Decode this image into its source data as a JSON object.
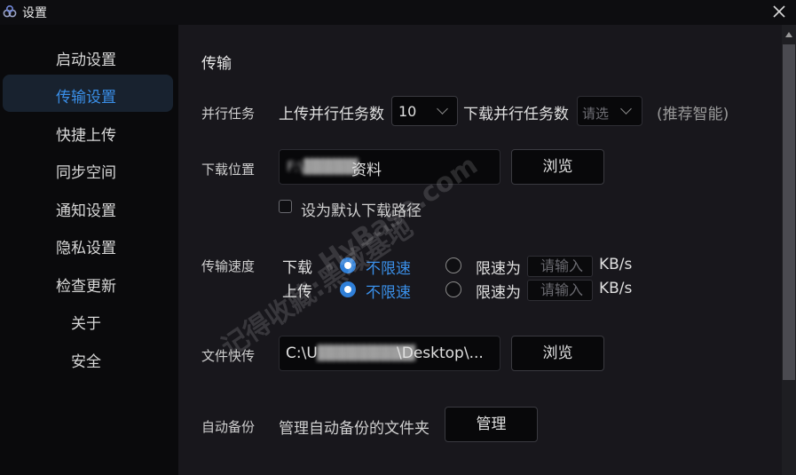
{
  "window": {
    "title": "设置",
    "close_icon": "close-icon"
  },
  "sidebar": {
    "items": [
      {
        "label": "启动设置"
      },
      {
        "label": "传输设置",
        "active": true
      },
      {
        "label": "快捷上传"
      },
      {
        "label": "同步空间"
      },
      {
        "label": "通知设置"
      },
      {
        "label": "隐私设置"
      },
      {
        "label": "检查更新"
      },
      {
        "label": "关于"
      },
      {
        "label": "安全"
      }
    ]
  },
  "main": {
    "section_title": "传输",
    "parallel": {
      "label": "并行任务",
      "upload_label": "上传并行任务数",
      "upload_value": "10",
      "download_label": "下载并行任务数",
      "download_placeholder": "请选",
      "hint": "(推荐智能)"
    },
    "download_location": {
      "label": "下载位置",
      "path_suffix": "资料",
      "browse_label": "浏览",
      "default_checkbox_label": "设为默认下载路径",
      "default_checked": false
    },
    "speed": {
      "label": "传输速度",
      "download": {
        "label": "下载",
        "unlimited_label": "不限速",
        "unlimited_selected": true,
        "limit_label": "限速为",
        "placeholder": "请输入",
        "unit": "KB/s"
      },
      "upload": {
        "label": "上传",
        "unlimited_label": "不限速",
        "unlimited_selected": true,
        "limit_label": "限速为",
        "placeholder": "请输入",
        "unit": "KB/s"
      }
    },
    "quick_transfer": {
      "label": "文件快传",
      "path_prefix": "C:\\U",
      "path_suffix": "\\Desktop\\...",
      "browse_label": "浏览"
    },
    "auto_backup": {
      "label": "自动备份",
      "desc": "管理自动备份的文件夹",
      "manage_label": "管理"
    }
  },
  "watermark": {
    "line1": "记得收藏:黑域基地",
    "line2": "HyBase.com"
  },
  "colors": {
    "accent": "#2f7fd8",
    "active_nav_bg": "#18222f",
    "background": "#18171c"
  }
}
